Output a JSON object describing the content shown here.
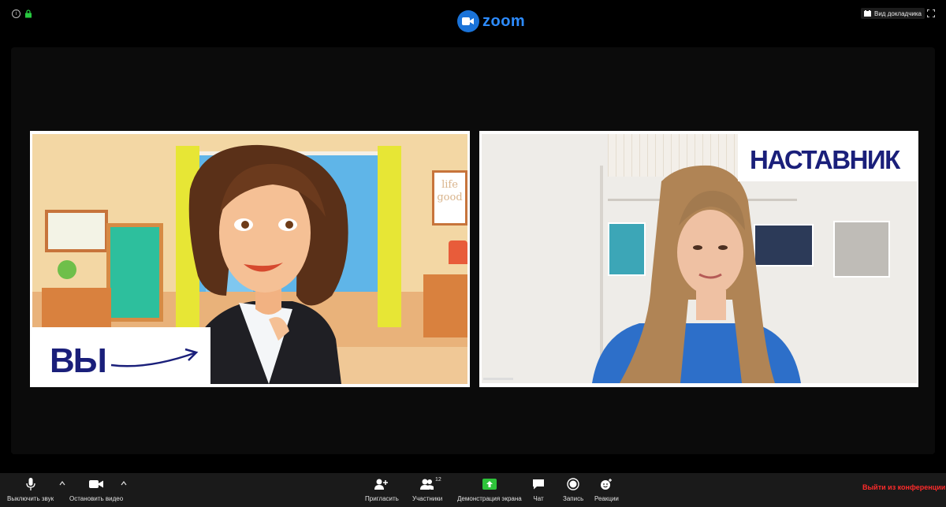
{
  "app": {
    "logo_text": "zoom",
    "brand_color": "#2d8cff"
  },
  "topbar": {
    "view_label": "Вид докладчика"
  },
  "tiles": {
    "you": {
      "label": "ВЫ",
      "sign_text": "life good"
    },
    "mentor": {
      "label": "НАСТАВНИК"
    }
  },
  "toolbar": {
    "mute_label": "Выключить звук",
    "video_label": "Остановить видео",
    "invite_label": "Пригласить",
    "participants_label": "Участники",
    "participants_count": "12",
    "share_label": "Демонстрация экрана",
    "chat_label": "Чат",
    "record_label": "Запись",
    "reactions_label": "Реакции",
    "leave_label": "Выйти из конференции"
  },
  "colors": {
    "share_green": "#2ec33a",
    "leave_red": "#ff2b2b",
    "label_navy": "#1a1f7a"
  },
  "icons": [
    "info-icon",
    "lock-icon",
    "zoom-logo-icon",
    "view-icon",
    "fullscreen-icon",
    "mic-icon",
    "video-icon",
    "invite-icon",
    "participants-icon",
    "share-icon",
    "chat-icon",
    "record-icon",
    "reactions-icon"
  ]
}
